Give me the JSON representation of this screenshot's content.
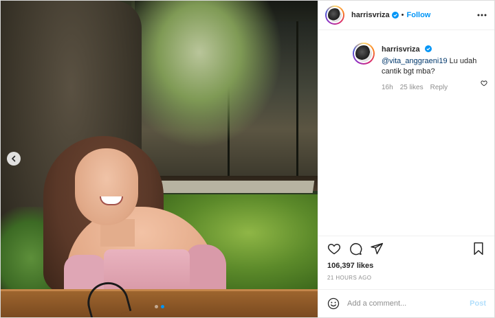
{
  "post": {
    "username": "harrisvriza",
    "follow_label": "Follow",
    "header_separator": "•",
    "likes": "106,397 likes",
    "time_ago": "21 HOURS AGO"
  },
  "comment": {
    "username": "harrisvriza",
    "mention": "@vita_anggraeni19",
    "text": " Lu udah cantik bgt mba?",
    "age": "16h",
    "likes": "25 likes",
    "reply_label": "Reply"
  },
  "add_comment": {
    "placeholder": "Add a comment...",
    "post_label": "Post"
  },
  "carousel": {
    "total_slides": 2,
    "active_slide": 2
  },
  "colors": {
    "accent": "#0095f6",
    "post_disabled": "#b2dffc",
    "meta_text": "#8e8e8e",
    "mention": "#00376b"
  },
  "icons": {
    "carousel_prev": "chevron-left-icon",
    "more": "more-horizontal-icon",
    "verified": "verified-badge-icon",
    "like": "heart-icon",
    "comment": "comment-bubble-icon",
    "share": "paper-plane-icon",
    "save": "bookmark-icon",
    "emoji": "smiley-icon"
  }
}
